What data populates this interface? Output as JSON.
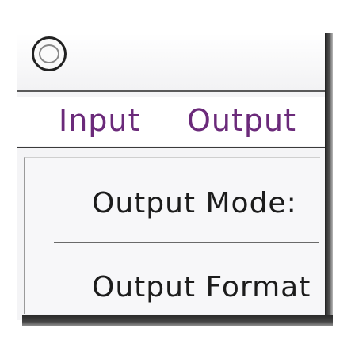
{
  "menubar": {
    "items": [
      {
        "label": "Input"
      },
      {
        "label": "Output"
      }
    ]
  },
  "dropdown": {
    "items": [
      {
        "label": "Output Mode:"
      },
      {
        "label": "Output Format"
      }
    ]
  },
  "icons": {
    "title": "app-circle-icon"
  },
  "colors": {
    "menu_text": "#6b2a7a",
    "item_text": "#1c1c1c",
    "frame_shadow": "#1e1e1e"
  }
}
